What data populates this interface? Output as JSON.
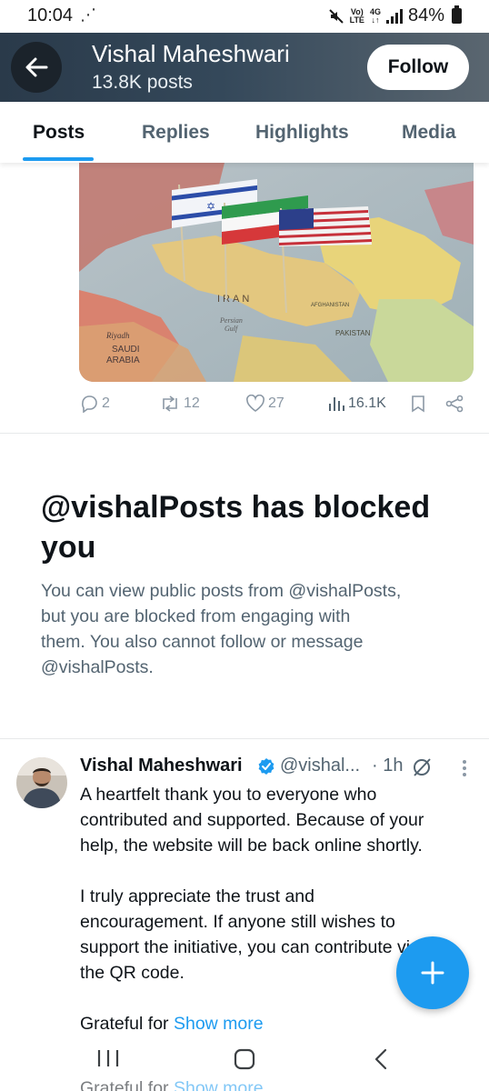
{
  "status_bar": {
    "time": "10:04",
    "network_top": "Vo)",
    "network_bottom": "LTE",
    "data_top": "4G",
    "data_bottom": "↓↑",
    "battery": "84%"
  },
  "header": {
    "name": "Vishal Maheshwari",
    "post_count": "13.8K posts",
    "follow_label": "Follow"
  },
  "tabs": [
    "Posts",
    "Replies",
    "Highlights",
    "Media"
  ],
  "image_post": {
    "image_labels": {
      "iran": "IRAN",
      "afghanistan": "AFGHANISTAN",
      "pakistan": "PAKISTAN",
      "saudi": "SAUDI",
      "arabia": "ARABIA",
      "riyadh": "Riyadh",
      "persian": "Persian",
      "gulf": "Gulf"
    },
    "actions": {
      "replies": "2",
      "reposts": "12",
      "likes": "27",
      "views": "16.1K"
    }
  },
  "blocked": {
    "title": "@vishalPosts has blocked you",
    "body": [
      "You can view public posts from @vishalPosts,",
      "but you are blocked from engaging with",
      "them. You also cannot follow or message",
      "@vishalPosts."
    ]
  },
  "tweet": {
    "name": "Vishal Maheshwari",
    "handle": "@vishal...",
    "time": "· 1h",
    "lines": [
      [
        "A heartfelt thank you to everyone who",
        "contributed and supported. Because of your",
        "help, the website will be back online shortly."
      ],
      [
        "I truly appreciate the trust and",
        "encouragement. If anyone still wishes to",
        "support the initiative, you can contribute via",
        "the QR code."
      ]
    ],
    "last_line_prefix": "Grateful for",
    "show_more": "Show more"
  },
  "colors": {
    "accent": "#1d9bf0",
    "header_bg": "#2a3a4a",
    "secondary_text": "#536471"
  },
  "icons": {
    "back": "arrow-left-icon",
    "reply": "reply-icon",
    "repost": "repost-icon",
    "like": "heart-icon",
    "views": "views-icon",
    "bookmark": "bookmark-icon",
    "share": "share-icon",
    "verified": "verified-badge-icon",
    "grok": "grok-icon",
    "more": "more-vertical-icon",
    "compose": "plus-icon",
    "nav_recents": "recents-icon",
    "nav_home": "home-icon",
    "nav_back": "back-icon"
  }
}
